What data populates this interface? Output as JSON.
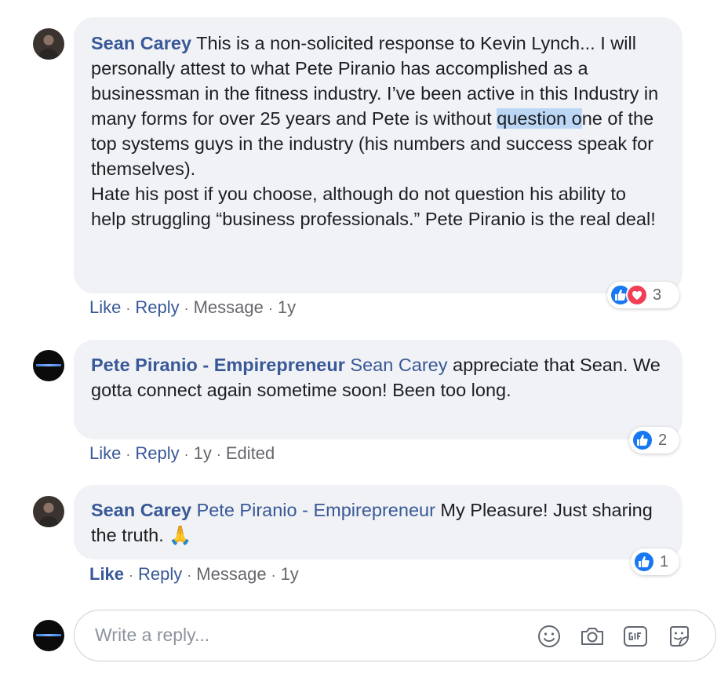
{
  "comments": [
    {
      "author": "Sean Carey",
      "text_before_highlight": " This is a non-solicited response to Kevin Lynch... I will personally attest to what Pete Piranio has accomplished as a businessman in the fitness industry. I’ve been active in this Industry in many forms for over 25 years and Pete is without ",
      "text_highlight": "question o",
      "text_after_highlight": "ne of the top systems guys in the industry (his numbers and success speak for themselves).",
      "text_para2": "Hate his post if you choose, although do not question his ability to help struggling “business professionals.” Pete Piranio is the real deal!",
      "reaction_count": "3",
      "reactions": [
        "like-icon",
        "love-icon"
      ],
      "actions": {
        "like": "Like",
        "reply": "Reply",
        "message": "Message",
        "time": "1y"
      }
    },
    {
      "author": "Pete Piranio - Empirepreneur",
      "mention": "Sean Carey",
      "text": " appreciate that Sean. We gotta connect again sometime soon! Been too long.",
      "reaction_count": "2",
      "reactions": [
        "like-icon"
      ],
      "actions": {
        "like": "Like",
        "reply": "Reply",
        "time": "1y",
        "edited": "Edited"
      }
    },
    {
      "author": "Sean Carey",
      "mention": "Pete Piranio - Empirepreneur",
      "text": " My Pleasure! Just sharing the truth. ",
      "emoji": "🙏",
      "reaction_count": "1",
      "reactions": [
        "like-icon"
      ],
      "actions": {
        "like": "Like",
        "reply": "Reply",
        "message": "Message",
        "time": "1y"
      }
    }
  ],
  "reply_box": {
    "placeholder": "Write a reply...",
    "tools": [
      "emoji-icon",
      "camera-icon",
      "gif-icon",
      "sticker-icon"
    ]
  },
  "colors": {
    "link": "#385898",
    "bubble": "#f0f2f5",
    "like": "#1877f2",
    "love": "#f33e58",
    "highlight": "#bcd7f5"
  }
}
